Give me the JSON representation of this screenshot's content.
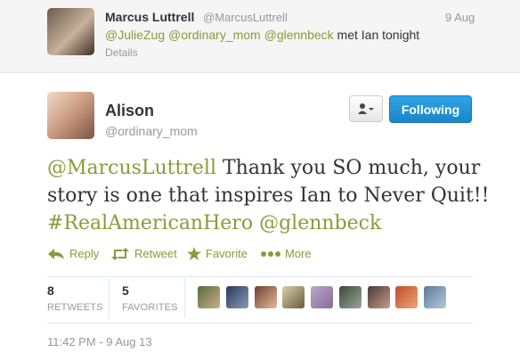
{
  "parent_tweet": {
    "name": "Marcus Luttrell",
    "handle": "@MarcusLuttrell",
    "time": "9 Aug",
    "mention1": "@JulieZug",
    "mention2": "@ordinary_mom",
    "mention3": "@glennbeck",
    "text_tail": " met Ian tonight",
    "details_label": "Details"
  },
  "tweet": {
    "author_name": "Alison",
    "author_handle": "@ordinary_mom",
    "follow_label": "Following",
    "text_mention": "@MarcusLuttrell",
    "text_body": " Thank you SO much, your story is one that inspires Ian to Never Quit!!",
    "text_hashtag": "#RealAmericanHero",
    "text_mention2": "@glennbeck",
    "timestamp": "11:42 PM - 9 Aug 13"
  },
  "actions": {
    "reply": "Reply",
    "retweet": "Retweet",
    "favorite": "Favorite",
    "more": "More"
  },
  "stats": {
    "retweets_count": "8",
    "retweets_label": "RETWEETS",
    "favorites_count": "5",
    "favorites_label": "FAVORITES"
  },
  "colors": {
    "link": "#8a9b3a",
    "follow_button": "#2fa4e7"
  }
}
